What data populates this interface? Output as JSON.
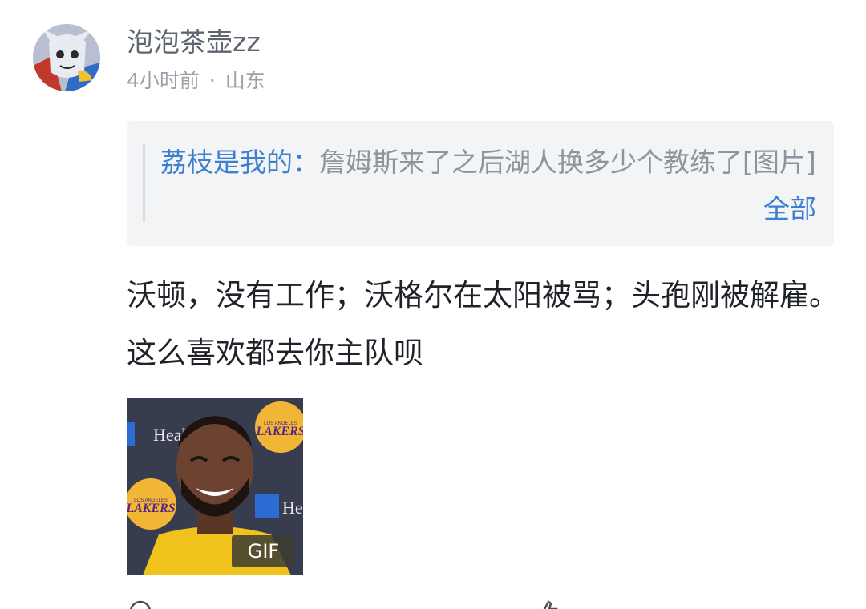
{
  "comment": {
    "username": "泡泡茶壶zz",
    "time": "4小时前",
    "separator": "·",
    "location": "山东",
    "quote": {
      "author": "荔枝是我的",
      "colon": "：",
      "text": "詹姆斯来了之后湖人换多少个教练了[图片]",
      "more_label": "全部"
    },
    "body": "沃顿，没有工作；沃格尔在太阳被骂；头孢刚被解雇。这么喜欢都去你主队呗",
    "media": {
      "type_badge": "GIF",
      "backdrop_text_1": "Healt",
      "backdrop_text_2": "He",
      "backdrop_logo_text": "LAKERS",
      "backdrop_logo_sub": "LOS ANGELES"
    }
  },
  "colors": {
    "link_blue": "#3f7fd0",
    "body_text": "#1f2329",
    "meta_gray": "#9aa0a9",
    "quote_bg": "#f3f4f6",
    "lakers_gold": "#f2b636",
    "lakers_purple": "#552583"
  },
  "icons": [
    "avatar-cartoon-cat",
    "comment-icon",
    "like-icon"
  ]
}
